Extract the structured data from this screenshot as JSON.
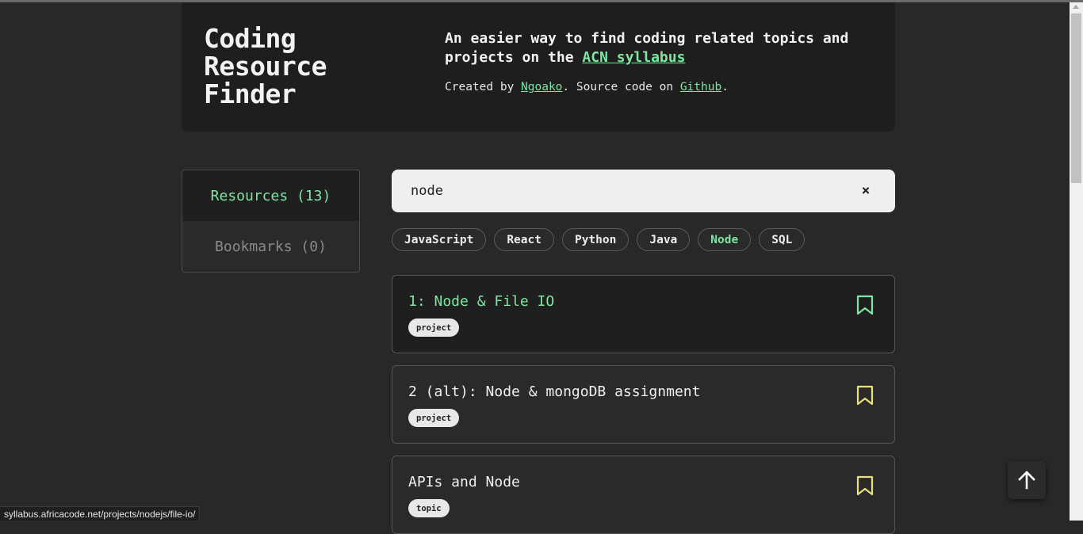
{
  "header": {
    "title_lines": [
      "Coding",
      "Resource",
      "Finder"
    ],
    "tagline_prefix": "An easier way to find coding related topics and projects on the ",
    "tagline_link": "ACN syllabus",
    "credits_prefix": "Created by ",
    "credits_author": "Ngoako",
    "credits_middle": ". Source code on ",
    "credits_source": "Github",
    "credits_suffix": "."
  },
  "sidebar": {
    "items": [
      {
        "label": "Resources (13)",
        "active": true
      },
      {
        "label": "Bookmarks (0)",
        "active": false
      }
    ]
  },
  "search": {
    "value": "node",
    "clear_icon": "×"
  },
  "tags": [
    {
      "label": "JavaScript",
      "active": false
    },
    {
      "label": "React",
      "active": false
    },
    {
      "label": "Python",
      "active": false
    },
    {
      "label": "Java",
      "active": false
    },
    {
      "label": "Node",
      "active": true
    },
    {
      "label": "SQL",
      "active": false
    }
  ],
  "results": [
    {
      "title": "1: Node & File IO",
      "type": "project",
      "highlight": true
    },
    {
      "title": "2 (alt): Node & mongoDB assignment",
      "type": "project",
      "highlight": false
    },
    {
      "title": "APIs and Node",
      "type": "topic",
      "highlight": false
    }
  ],
  "colors": {
    "accent": "#7fe5a2",
    "bookmark_active": "#7fe5a2",
    "bookmark": "#e9e07a",
    "background": "#282828"
  },
  "status_url": "syllabus.africacode.net/projects/nodejs/file-io/"
}
